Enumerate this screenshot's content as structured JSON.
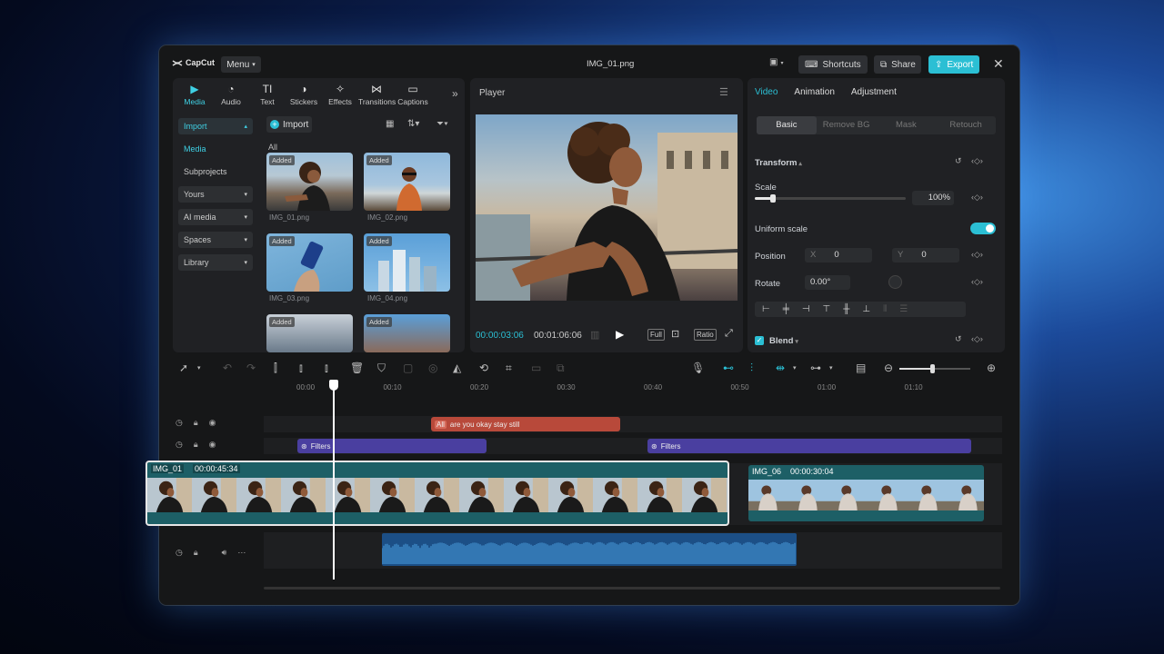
{
  "app": {
    "logo": "CapCut",
    "menu": "Menu",
    "file_title": "IMG_01.png",
    "shortcuts": "Shortcuts",
    "share": "Share",
    "export": "Export"
  },
  "media_tabs": [
    {
      "label": "Media",
      "icon": "media-icon",
      "active": true
    },
    {
      "label": "Audio",
      "icon": "audio-icon"
    },
    {
      "label": "Text",
      "icon": "text-icon"
    },
    {
      "label": "Stickers",
      "icon": "stickers-icon"
    },
    {
      "label": "Effects",
      "icon": "effects-icon"
    },
    {
      "label": "Transitions",
      "icon": "transitions-icon"
    },
    {
      "label": "Captions",
      "icon": "captions-icon"
    }
  ],
  "sidebar": {
    "import": "Import",
    "media": "Media",
    "subprojects": "Subprojects",
    "yours": "Yours",
    "ai_media": "AI media",
    "spaces": "Spaces",
    "library": "Library"
  },
  "library": {
    "import_button": "Import",
    "all_label": "All",
    "added_badge": "Added",
    "items": [
      {
        "name": "IMG_01.png"
      },
      {
        "name": "IMG_02.png"
      },
      {
        "name": "IMG_03.png"
      },
      {
        "name": "IMG_04.png"
      }
    ]
  },
  "player": {
    "title": "Player",
    "current_time": "00:00:03:06",
    "total_time": "00:01:06:06",
    "full": "Full",
    "ratio": "Ratio"
  },
  "inspector": {
    "tabs": [
      "Video",
      "Animation",
      "Adjustment"
    ],
    "sub_tabs": [
      "Basic",
      "Remove BG",
      "Mask",
      "Retouch"
    ],
    "transform": "Transform",
    "scale_label": "Scale",
    "scale_value": "100%",
    "scale_fraction": 0.12,
    "uniform_scale": "Uniform scale",
    "position_label": "Position",
    "pos_x_label": "X",
    "pos_x": "0",
    "pos_y_label": "Y",
    "pos_y": "0",
    "rotate_label": "Rotate",
    "rotate_value": "0.00°",
    "blend": "Blend"
  },
  "timeline": {
    "ruler": [
      "00:00",
      "00:10",
      "00:20",
      "00:30",
      "00:40",
      "00:50",
      "01:00",
      "01:10"
    ],
    "text_clip": "are you okay stay still",
    "text_clip_badge": "All",
    "filter_label": "Filters",
    "main_clip_name": "IMG_01",
    "main_clip_duration": "00:00:45:34",
    "clip2_name": "IMG_06",
    "clip2_duration": "00:00:30:04"
  },
  "colors": {
    "accent": "#2bbfd4",
    "text_clip": "#b8493a",
    "filter_clip": "#4a3fa0",
    "video_clip": "#1d5f66",
    "audio": "#1c4f86"
  }
}
